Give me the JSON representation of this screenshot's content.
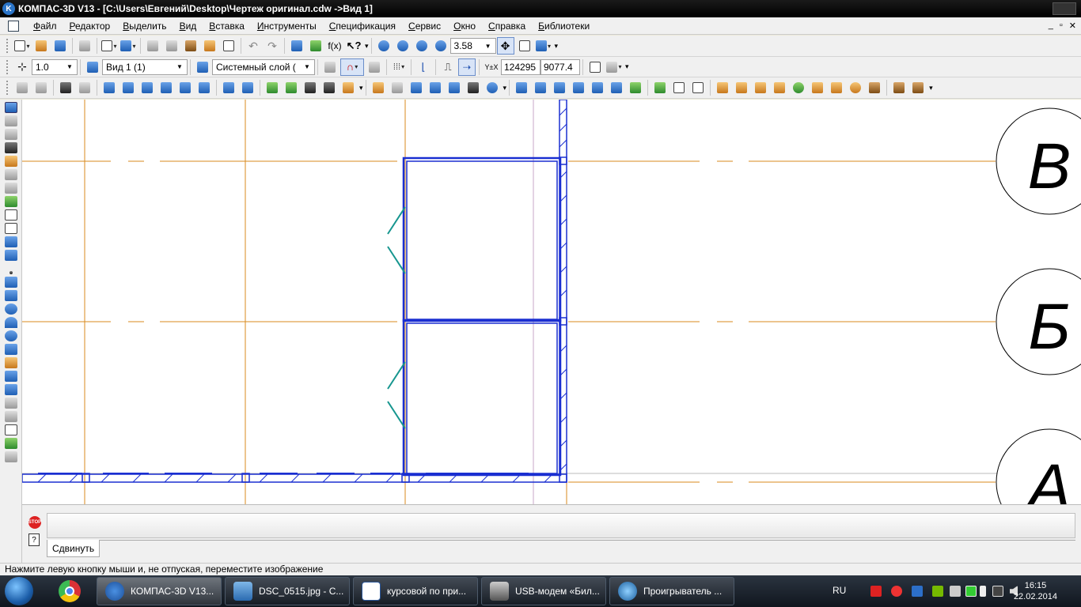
{
  "window": {
    "title": "КОМПАС-3D V13 - [C:\\Users\\Евгений\\Desktop\\Чертеж оригинал.cdw ->Вид 1]"
  },
  "menu": {
    "items": [
      "Файл",
      "Редактор",
      "Выделить",
      "Вид",
      "Вставка",
      "Инструменты",
      "Спецификация",
      "Сервис",
      "Окно",
      "Справка",
      "Библиотеки"
    ]
  },
  "toolbar1": {
    "zoom_value": "3.58"
  },
  "toolbar2": {
    "step_value": "1.0",
    "view_value": "Вид 1 (1)",
    "layer_value": "Системный слой (",
    "coord_x": "124295",
    "coord_y": "9077.4"
  },
  "drawing": {
    "axis_labels": [
      "В",
      "Б",
      "А"
    ],
    "colors": {
      "axis": "#d98a1e",
      "wall": "#1a2fd1",
      "opening": "#17968f",
      "outline": "#000000"
    }
  },
  "command_panel": {
    "tab_label": "Сдвинуть"
  },
  "status": {
    "message": "Нажмите левую кнопку мыши и, не отпуская, переместите изображение"
  },
  "taskbar": {
    "items": [
      {
        "label": "КОМПАС-3D V13...",
        "active": true
      },
      {
        "label": "DSC_0515.jpg - C...",
        "active": false
      },
      {
        "label": "курсовой по при...",
        "active": false
      },
      {
        "label": "USB-модем «Бил...",
        "active": false
      },
      {
        "label": "Проигрыватель ...",
        "active": false
      }
    ],
    "language": "RU",
    "time": "16:15",
    "date": "22.02.2014"
  }
}
